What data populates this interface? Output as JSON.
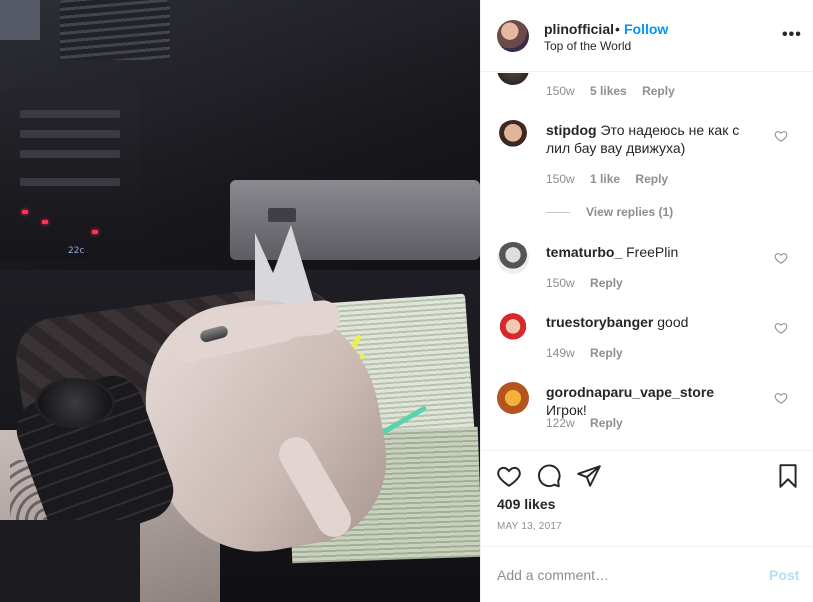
{
  "header": {
    "username": "plinofficial",
    "separator": "•",
    "follow_label": "Follow",
    "location": "Top of the World",
    "more_label": "•••"
  },
  "comments": [
    {
      "username": "",
      "text": "",
      "age": "150w",
      "likes": "5 likes",
      "reply": "Reply"
    },
    {
      "username": "stipdog",
      "text": "Это надеюсь не как с лил бау вау движуха)",
      "age": "150w",
      "likes": "1 like",
      "reply": "Reply",
      "view_replies": "View replies (1)"
    },
    {
      "username": "tematurbo_",
      "text": "FreePlin",
      "age": "150w",
      "reply": "Reply"
    },
    {
      "username": "truestorybanger",
      "text": "good",
      "age": "149w",
      "reply": "Reply"
    },
    {
      "username": "gorodnaparu_vape_store",
      "text": "Игрок!",
      "age": "122w",
      "reply": "Reply"
    }
  ],
  "post": {
    "likes": "409 likes",
    "date": "MAY 13, 2017"
  },
  "compose": {
    "placeholder": "Add a comment…",
    "post_label": "Post"
  },
  "photo": {
    "dashboard_temp": "22c"
  },
  "colors": {
    "link": "#0095f6",
    "post_disabled": "#b2dffc",
    "meta": "#8e8e8e"
  }
}
